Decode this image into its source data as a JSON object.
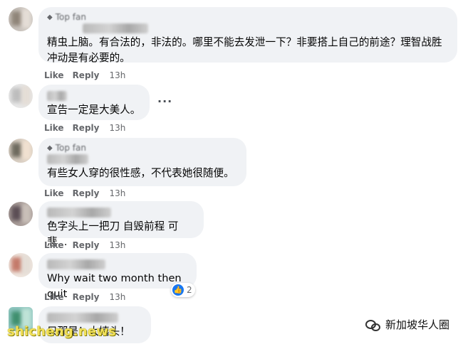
{
  "comments": [
    {
      "badge": "Top fan",
      "text_lines": [
        "精虫上脑。有合法的，非法的。哪里不能去发泄一下？非要搭上自己的前途？理智战胜",
        "冲动是有必要的。"
      ],
      "like": "Like",
      "reply": "Reply",
      "time": "13h"
    },
    {
      "badge": "",
      "text_lines": [
        "宣告一定是大美人。"
      ],
      "like": "Like",
      "reply": "Reply",
      "time": "13h",
      "more": "···"
    },
    {
      "badge": "Top fan",
      "text_lines": [
        "有些女人穿的很性感，不代表她很随便。"
      ],
      "like": "Like",
      "reply": "Reply",
      "time": "13h"
    },
    {
      "badge": "",
      "text_lines": [
        "色字头上一把刀 自毁前程 可悲..."
      ],
      "like": "Like",
      "reply": "Reply",
      "time": "13h"
    },
    {
      "badge": "",
      "text_lines": [
        "Why wait two month then quit"
      ],
      "like": "Like",
      "reply": "Reply",
      "time": "13h",
      "reaction_count": "2"
    },
    {
      "badge": "",
      "text_lines": [
        "只那是！大嬉头！"
      ],
      "like": "",
      "reply": "",
      "time": ""
    }
  ],
  "watermark": "shicheng.news",
  "wechat_account": "新加坡华人圈",
  "icons": {
    "badge": "diamond-icon",
    "reaction": "thumbs-up-icon",
    "more": "more-options-icon",
    "wechat": "wechat-icon"
  },
  "colors": {
    "bubble": "#f0f2f5",
    "meta": "#65676b",
    "like_blue": "#1877f2"
  }
}
